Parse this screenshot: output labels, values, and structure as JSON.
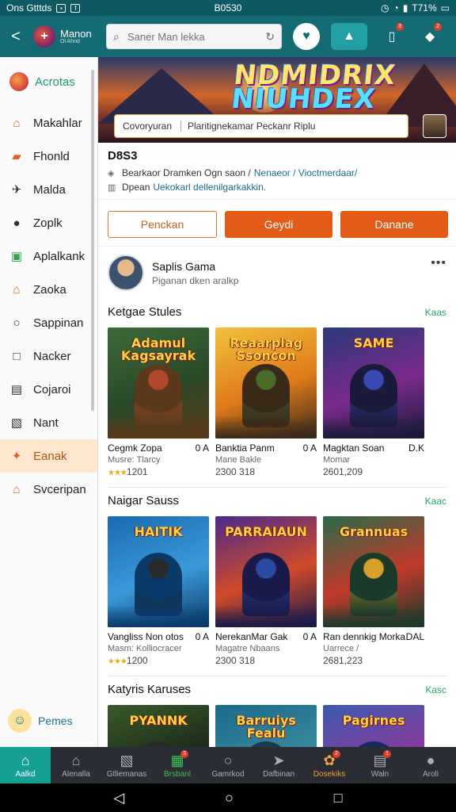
{
  "status": {
    "left": "Ons Gtttds",
    "time": "B0530",
    "battery": "T71%"
  },
  "brand": {
    "name": "Manon",
    "sub": "Ol Ahnd"
  },
  "search": {
    "placeholder": "Saner Man lekka"
  },
  "topbar": {
    "badge_cart": "3",
    "badge_notify": "2"
  },
  "sidebar": {
    "head": "Acrotas",
    "items": [
      {
        "label": "Makahlar",
        "icon": "home-icon"
      },
      {
        "label": "Fhonld",
        "icon": "folder-icon"
      },
      {
        "label": "Malda",
        "icon": "pin-icon"
      },
      {
        "label": "Zoplk",
        "icon": "user-icon"
      },
      {
        "label": "Aplalkank",
        "icon": "camera-icon"
      },
      {
        "label": "Zaoka",
        "icon": "store-icon"
      },
      {
        "label": "Sappinan",
        "icon": "search-icon"
      },
      {
        "label": "Nacker",
        "icon": "square-icon"
      },
      {
        "label": "Cojaroi",
        "icon": "doc-icon"
      },
      {
        "label": "Nant",
        "icon": "image-icon"
      },
      {
        "label": "Eanak",
        "icon": "trophy-icon"
      },
      {
        "label": "Svceripan",
        "icon": "house-icon"
      }
    ],
    "active_index": 10,
    "footer": "Pemes"
  },
  "hero": {
    "title_line1": "NDMIDRIX",
    "title_line2": "NIUHDEX",
    "search_seg1": "Covoryuran",
    "search_seg2": "Plaritignekamar Peckanr Riplu"
  },
  "info": {
    "title": "D8S3",
    "line1_text": "Bearkaor Dramken Ogn saon /",
    "line1_link": "Nenaeor / Vioctmerdaar/",
    "line2_text": "Dpean",
    "line2_link": "Uekokarl dellenilgarkakkin."
  },
  "actions": {
    "btn1": "Penckan",
    "btn2": "Geydi",
    "btn3": "Danane"
  },
  "profile": {
    "name": "Saplis Gama",
    "sub": "Piganan dken aralkp"
  },
  "sections": [
    {
      "title": "Ketgae Stules",
      "more": "Kaas",
      "cards": [
        {
          "art": "Adamul Kagsayrak",
          "name": "Cegmk Zopa",
          "tag": "0 A",
          "sub": "Musre: Tlarcy",
          "stars": "★★★",
          "num": "1201",
          "palette": [
            "#3e6b3a",
            "#2a4a2a",
            "#b04a2a",
            "#5a3a1a"
          ]
        },
        {
          "art": "Reaarplag Ssoncon",
          "name": "Banktia Panm",
          "tag": "0 A",
          "sub": "Mane Bakle",
          "stars": "",
          "num": "2300 318",
          "palette": [
            "#f2c23a",
            "#e07a1a",
            "#4a6a2a",
            "#3a2a1a"
          ]
        },
        {
          "art": "SAME",
          "name": "Magktan Soan",
          "tag": "D.K",
          "sub": "Momar",
          "stars": "",
          "num": "2601,209",
          "palette": [
            "#2a3a7a",
            "#7a2a8a",
            "#3a4ab0",
            "#1a1a3a"
          ]
        }
      ]
    },
    {
      "title": "Naigar Sauss",
      "more": "Kaac",
      "cards": [
        {
          "art": "HAITIK",
          "name": "Vangliss Non otos",
          "tag": "0 A",
          "sub": "Masm: Kolliocracer",
          "stars": "★★★",
          "num": "1200",
          "palette": [
            "#1a6ab0",
            "#3a9ad8",
            "#2a2a2a",
            "#0a3a6a"
          ]
        },
        {
          "art": "PARRAIAUN",
          "name": "NerekanMar Gak",
          "tag": "0 A",
          "sub": "Magatre Nbaans",
          "stars": "",
          "num": "2300 318",
          "palette": [
            "#4a2a8a",
            "#d04a2a",
            "#2a4aa0",
            "#1a1a4a"
          ]
        },
        {
          "art": "Grannuas",
          "name": "Ran dennkig Morka",
          "tag": "DAL",
          "sub": "Uarrece /",
          "stars": "",
          "num": "2681,223",
          "palette": [
            "#2a6a4a",
            "#c03a2a",
            "#d8a02a",
            "#1a3a2a"
          ]
        }
      ]
    },
    {
      "title": "Katyris Karuses",
      "more": "Kasc",
      "cards": [
        {
          "art": "PYANNK",
          "name": "",
          "tag": "",
          "sub": "",
          "stars": "",
          "num": "",
          "palette": [
            "#3a5a2a",
            "#1a2a1a",
            "#e0a02a",
            "#2a2a2a"
          ]
        },
        {
          "art": "Barruiys Fealu",
          "name": "",
          "tag": "",
          "sub": "",
          "stars": "",
          "num": "",
          "palette": [
            "#1a6a8a",
            "#3a8aa0",
            "#e0a02a",
            "#1a3a4a"
          ]
        },
        {
          "art": "Pagirnes",
          "name": "",
          "tag": "",
          "sub": "",
          "stars": "",
          "num": "",
          "palette": [
            "#3a5ab0",
            "#8a3a9a",
            "#d04a2a",
            "#1a2a5a"
          ]
        }
      ]
    }
  ],
  "bottomnav": [
    {
      "label": "Aalkd",
      "icon": "home-icon"
    },
    {
      "label": "Alenalla",
      "icon": "house-icon"
    },
    {
      "label": "Gtliemanas",
      "icon": "image-icon"
    },
    {
      "label": "Brsbanl",
      "icon": "bag-icon",
      "badge": "3"
    },
    {
      "label": "Gamrkod",
      "icon": "search-icon"
    },
    {
      "label": "Dafbinan",
      "icon": "send-icon"
    },
    {
      "label": "Dosekiks",
      "icon": "gift-icon",
      "badge": "2"
    },
    {
      "label": "Waln",
      "icon": "doc-icon",
      "badge": "1"
    },
    {
      "label": "Aroli",
      "icon": "user-icon"
    }
  ]
}
